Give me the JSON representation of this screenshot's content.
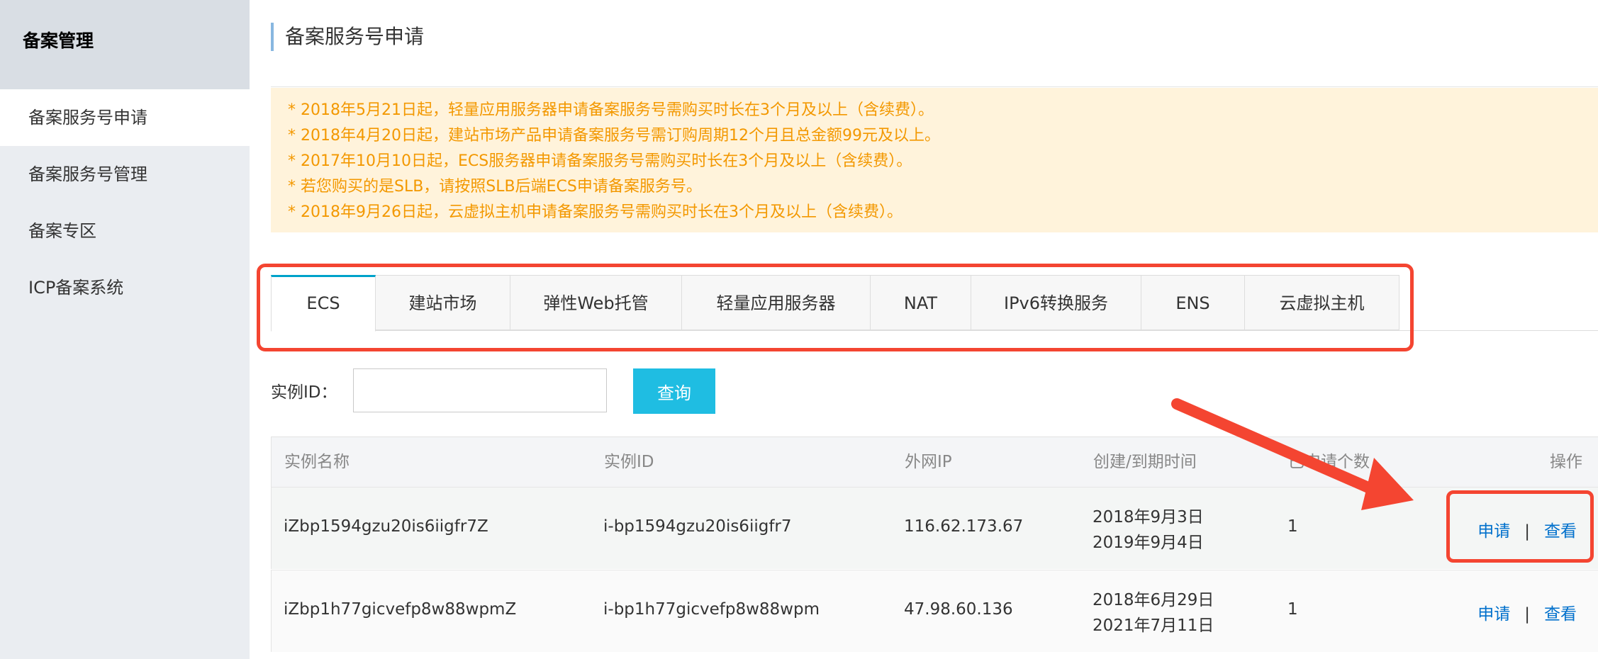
{
  "sidebar": {
    "title": "备案管理",
    "items": [
      {
        "label": "备案服务号申请"
      },
      {
        "label": "备案服务号管理"
      },
      {
        "label": "备案专区"
      },
      {
        "label": "ICP备案系统"
      }
    ]
  },
  "header": {
    "title": "备案服务号申请"
  },
  "notice": {
    "lines": [
      "* 2018年5月21日起，轻量应用服务器申请备案服务号需购买时长在3个月及以上（含续费）。",
      "* 2018年4月20日起，建站市场产品申请备案服务号需订购周期12个月且总金额99元及以上。",
      "* 2017年10月10日起，ECS服务器申请备案服务号需购买时长在3个月及以上（含续费）。",
      "* 若您购买的是SLB，请按照SLB后端ECS申请备案服务号。",
      "* 2018年9月26日起，云虚拟主机申请备案服务号需购买时长在3个月及以上（含续费）。"
    ]
  },
  "tabs": [
    {
      "label": "ECS"
    },
    {
      "label": "建站市场"
    },
    {
      "label": "弹性Web托管"
    },
    {
      "label": "轻量应用服务器"
    },
    {
      "label": "NAT"
    },
    {
      "label": "IPv6转换服务"
    },
    {
      "label": "ENS"
    },
    {
      "label": "云虚拟主机"
    }
  ],
  "search": {
    "label": "实例ID：",
    "value": "",
    "button": "查询"
  },
  "table": {
    "headers": [
      "实例名称",
      "实例ID",
      "外网IP",
      "创建/到期时间",
      "已申请个数",
      "操作"
    ],
    "rows": [
      {
        "name": "iZbp1594gzu20is6iigfr7Z",
        "id": "i-bp1594gzu20is6iigfr7",
        "ip": "116.62.173.67",
        "created": "2018年9月3日",
        "expires": "2019年9月4日",
        "count": "1",
        "apply": "申请",
        "sep": "|",
        "view": "查看"
      },
      {
        "name": "iZbp1h77gicvefp8w88wpmZ",
        "id": "i-bp1h77gicvefp8w88wpm",
        "ip": "47.98.60.136",
        "created": "2018年6月29日",
        "expires": "2021年7月11日",
        "count": "1",
        "apply": "申请",
        "sep": "|",
        "view": "查看"
      }
    ]
  },
  "colors": {
    "accent": "#1fbde2",
    "highlight": "#f44531",
    "notice_text": "#f39800",
    "link": "#0070cc"
  }
}
